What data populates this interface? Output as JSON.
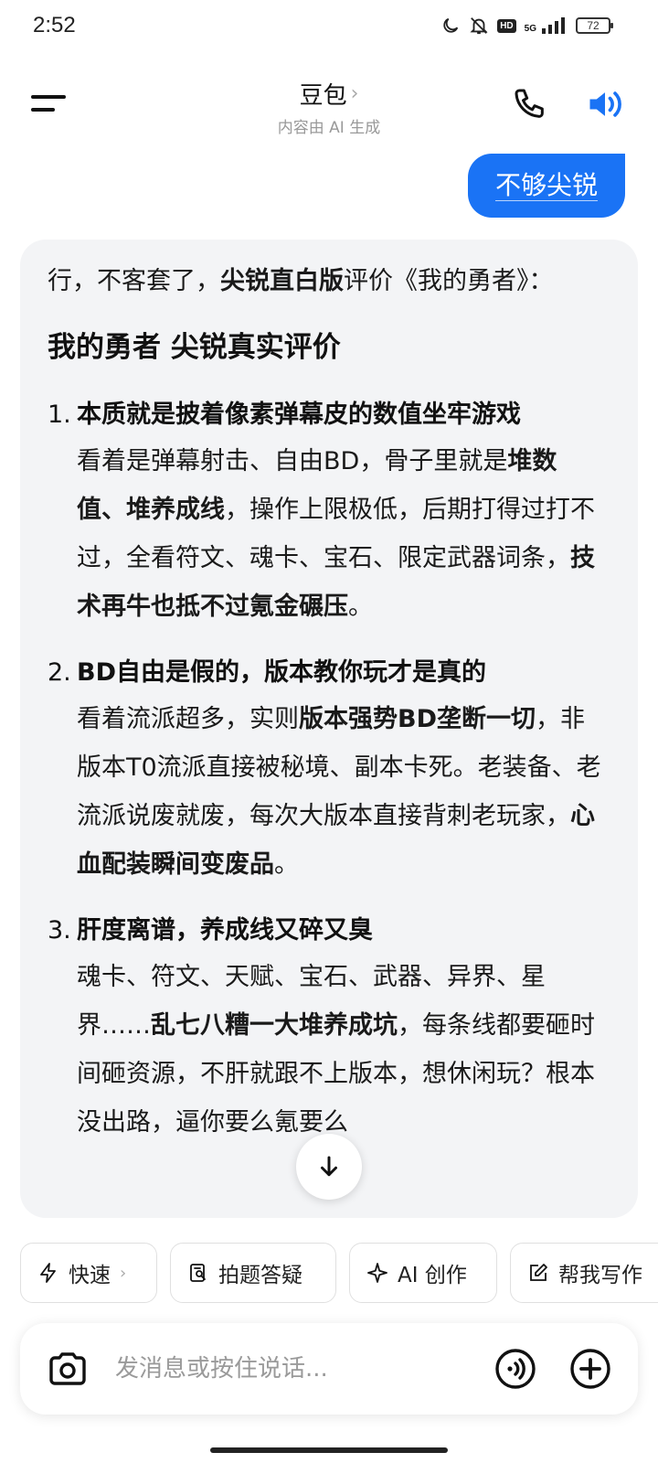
{
  "status_bar": {
    "time": "2:52",
    "network": "5G",
    "hd": "HD",
    "battery": "72",
    "icons": [
      "moon-icon",
      "bell-off-icon",
      "hd-icon",
      "signal-icon",
      "battery-icon"
    ]
  },
  "header": {
    "title": "豆包",
    "subtitle": "内容由 AI 生成",
    "icons": [
      "menu-icon",
      "chevron-right-icon",
      "phone-icon",
      "speaker-icon"
    ]
  },
  "user_message": {
    "text": "不够尖锐"
  },
  "ai_message": {
    "intro": {
      "pre": "行，不客套了，",
      "bold": "尖锐直白版",
      "post": "评价《我的勇者》："
    },
    "heading": "我的勇者 尖锐真实评价",
    "items": [
      {
        "number": "1.",
        "title": "本质就是披着像素弹幕皮的数值坐牢游戏",
        "text_1": "看着是弹幕射击、自由BD，骨子里就是",
        "bold_1": "堆数值、堆养成线",
        "text_2": "，操作上限极低，后期打得过打不过，全看符文、魂卡、宝石、限定武器词条，",
        "bold_2": "技术再牛也抵不过氪金碾压",
        "text_3": "。"
      },
      {
        "number": "2.",
        "title": "BD自由是假的，版本教你玩才是真的",
        "text_1": "看着流派超多，实则",
        "bold_1": "版本强势BD垄断一切",
        "text_2": "，非版本T0流派直接被秘境、副本卡死。老装备、老流派说废就废，每次大版本直接背刺老玩家，",
        "bold_2": "心血配装瞬间变废品",
        "text_3": "。"
      },
      {
        "number": "3.",
        "title": "肝度离谱，养成线又碎又臭",
        "text_1": "魂卡、符文、天赋、宝石、武器、异界、星界……",
        "bold_1": "乱七八糟一大堆养成坑",
        "text_2": "，每条线都要砸时间砸资源，不肝就跟不上版本，想休闲玩？根本没出路，逼你要么氪要么",
        "bold_2": "",
        "text_3": ""
      }
    ]
  },
  "quick_actions": [
    {
      "label": "快速",
      "icon": "lightning-icon"
    },
    {
      "label": "拍题答疑",
      "icon": "photo-search-icon"
    },
    {
      "label": "AI 创作",
      "icon": "sparkle-icon"
    },
    {
      "label": "帮我写作",
      "icon": "edit-icon"
    }
  ],
  "input": {
    "placeholder": "发消息或按住说话...",
    "icons": [
      "camera-icon",
      "voice-icon",
      "plus-icon"
    ]
  },
  "colors": {
    "accent": "#1a73f5",
    "card_bg": "#f3f4f6"
  }
}
